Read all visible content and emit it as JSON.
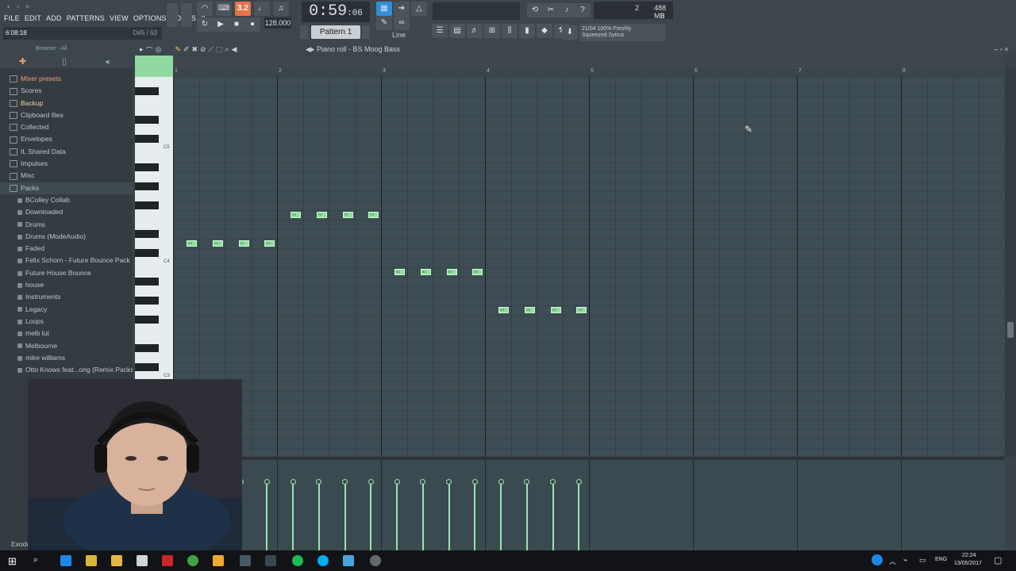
{
  "menu": [
    "FILE",
    "EDIT",
    "ADD",
    "PATTERNS",
    "VIEW",
    "OPTIONS",
    "TOOLS",
    "?"
  ],
  "hint": {
    "left": "6:08:18",
    "right": "D#5 / 63"
  },
  "transport": {
    "mode_badge": "3.2",
    "time_main": "0:59",
    "time_small": ":06",
    "tempo": "128.000",
    "pattern": "Pattern 1",
    "snap": "Line"
  },
  "cpu": {
    "voices": "2",
    "memory": "488 MB",
    "poly": "0"
  },
  "hint_panel": {
    "line1": "21/04  100% Freshly",
    "line2": "Squeezed Sytrus"
  },
  "browser": {
    "header": "Browser - All",
    "top_items": [
      {
        "label": "Mixer presets",
        "style": "hl"
      },
      {
        "label": "Scores",
        "style": ""
      },
      {
        "label": "Backup",
        "style": "bk"
      },
      {
        "label": "Clipboard files",
        "style": ""
      },
      {
        "label": "Collected",
        "style": ""
      },
      {
        "label": "Envelopes",
        "style": ""
      },
      {
        "label": "IL Shared Data",
        "style": ""
      },
      {
        "label": "Impulses",
        "style": ""
      },
      {
        "label": "Misc",
        "style": ""
      },
      {
        "label": "Packs",
        "style": "pk"
      }
    ],
    "packs": [
      "BColley Collab",
      "Downloaded",
      "Drums",
      "Drums (ModeAudio)",
      "Faded",
      "Felix Schorn - Future Bounce Pack",
      "Future House Bounce",
      "house",
      "Instruments",
      "Legacy",
      "Loops",
      "melb lut",
      "Melbourne",
      "mike williams",
      "Otto Knows feat...ong (Remix Packs)"
    ],
    "last_item": "Exodus Fill"
  },
  "piano_roll": {
    "title": "Piano roll - BS Moog Bass",
    "bar_numbers": [
      "1",
      "2",
      "3",
      "4",
      "5",
      "6",
      "7",
      "8"
    ],
    "key_labels": [
      "C5",
      "C4",
      "C3"
    ],
    "notes": [
      {
        "label": "D4",
        "row": "d4"
      },
      {
        "label": "D4",
        "row": "d4"
      },
      {
        "label": "D4",
        "row": "d4"
      },
      {
        "label": "D4",
        "row": "d4"
      },
      {
        "label": "F4",
        "row": "f4"
      },
      {
        "label": "F4",
        "row": "f4"
      },
      {
        "label": "F4",
        "row": "f4"
      },
      {
        "label": "F4",
        "row": "f4"
      },
      {
        "label": "B3",
        "row": "b3"
      },
      {
        "label": "B3",
        "row": "b3"
      },
      {
        "label": "B3",
        "row": "b3"
      },
      {
        "label": "B3",
        "row": "b3"
      },
      {
        "label": "G3",
        "row": "g3"
      },
      {
        "label": "G3",
        "row": "g3"
      },
      {
        "label": "G3",
        "row": "g3"
      },
      {
        "label": "G3",
        "row": "g3"
      }
    ]
  },
  "taskbar": {
    "lang": "ENG",
    "time": "22:24",
    "date": "13/05/2017"
  }
}
